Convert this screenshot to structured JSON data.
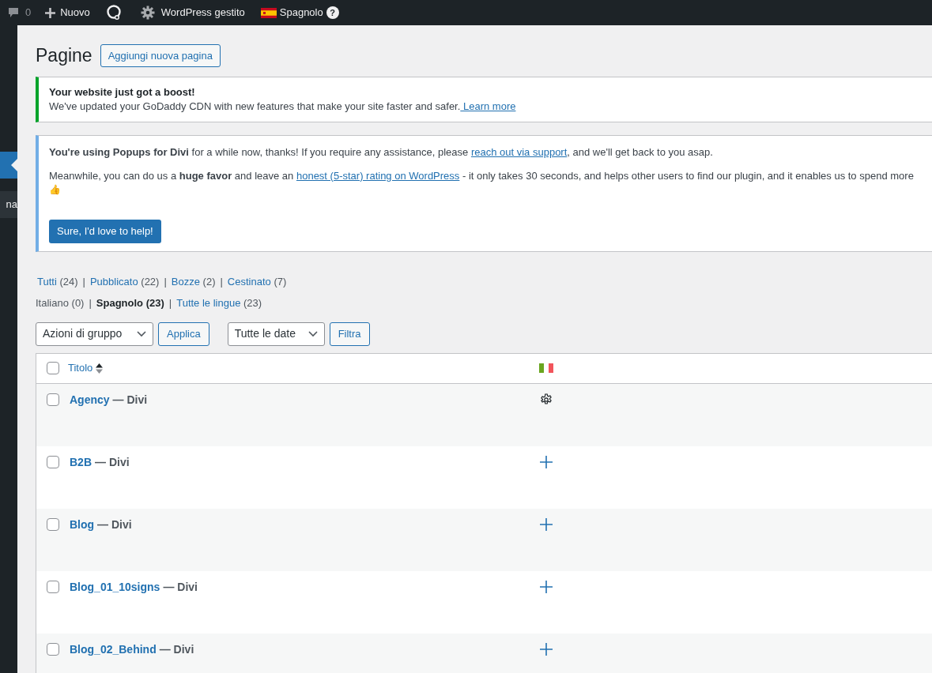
{
  "admin_bar": {
    "comments_count": "0",
    "new_label": "Nuovo",
    "managed_label": "WordPress gestito",
    "language": {
      "kind": "es",
      "label": "Spagnolo"
    },
    "help_label": "?"
  },
  "sidebar": {
    "items": [
      {
        "selected": true
      },
      {
        "label": "na",
        "selected": false
      }
    ]
  },
  "page": {
    "title": "Pagine",
    "add_button": "Aggiungi nuova pagina"
  },
  "notices": [
    {
      "kind": "success",
      "title": "Your website just got a boost!",
      "paragraphs": [
        [
          {
            "kind": "text",
            "text": "We've updated your GoDaddy CDN with new features that make your site faster and safer."
          },
          {
            "kind": "link",
            "text": " Learn more"
          }
        ]
      ]
    },
    {
      "kind": "info",
      "paragraphs": [
        [
          {
            "kind": "text",
            "text": "**You're using Popups for Divi** for a while now, thanks! If you require any assistance, please "
          },
          {
            "kind": "link",
            "text": "reach out via support"
          },
          {
            "kind": "text",
            "text": ", and we'll get back to you asap."
          }
        ],
        [
          {
            "kind": "text",
            "text": "Meanwhile, you can do us a **huge favor** and leave an "
          },
          {
            "kind": "link",
            "text": "honest (5-star) rating on WordPress"
          },
          {
            "kind": "text",
            "text": " - it only takes 30 seconds, and helps other users to find our plugin, and it enables us to spend more"
          }
        ]
      ],
      "emoji": "👍",
      "button": "Sure, I'd love to help!"
    }
  ],
  "status_filters": [
    {
      "kind": "link",
      "label": "Tutti",
      "count": "(24)",
      "selected": false,
      "separator": "|"
    },
    {
      "kind": "link",
      "label": "Pubblicato",
      "count": "(22)",
      "selected": false,
      "separator": "|"
    },
    {
      "kind": "link",
      "label": "Bozze",
      "count": "(2)",
      "selected": false,
      "separator": "|"
    },
    {
      "kind": "link",
      "label": "Cestinato",
      "count": "(7)",
      "selected": false
    }
  ],
  "language_filters": [
    {
      "kind": "text",
      "label": "Italiano",
      "count": "(0)",
      "selected": false,
      "separator": "|"
    },
    {
      "kind": "text",
      "label": "Spagnolo",
      "count": "(23)",
      "selected": true,
      "separator": "|"
    },
    {
      "kind": "link",
      "label": "Tutte le lingue",
      "count": "(23)",
      "selected": false
    }
  ],
  "toolbar": {
    "bulk_select": "Azioni di gruppo",
    "apply_button": "Applica",
    "date_select": "Tutte le date",
    "filter_button": "Filtra"
  },
  "table": {
    "select_all_checked": false,
    "title_column": "Titolo",
    "language_column": {
      "kind": "it"
    },
    "rows": [
      {
        "title": "Agency",
        "suffix": "— Divi",
        "checked": false,
        "kind": "edit"
      },
      {
        "title": "B2B",
        "suffix": "— Divi",
        "checked": false,
        "kind": "add"
      },
      {
        "title": "Blog",
        "suffix": "— Divi",
        "checked": false,
        "kind": "add"
      },
      {
        "title": "Blog_01_10signs",
        "suffix": "— Divi",
        "checked": false,
        "kind": "add"
      },
      {
        "title": "Blog_02_Behind",
        "suffix": "— Divi",
        "checked": false,
        "kind": "add"
      }
    ]
  }
}
